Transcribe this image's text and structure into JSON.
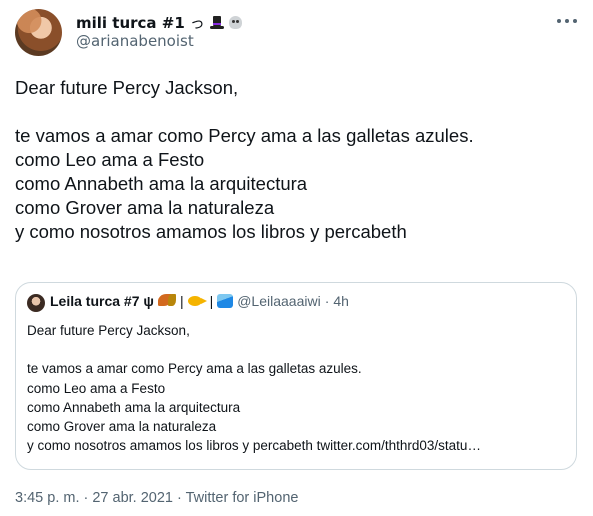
{
  "author": {
    "name": "mili turca #1",
    "name_suffix": "っ",
    "handle": "@arianabenoist",
    "badge_icons": [
      "top-hat-icon",
      "skull-icon"
    ]
  },
  "tweet": {
    "text": "Dear future Percy Jackson,\n\nte vamos a amar como Percy ama a las galletas azules.\ncomo Leo ama a Festo\ncomo Annabeth ama la arquitectura\ncomo Grover ama la naturaleza\ny como nosotros amamos los libros y percabeth"
  },
  "quote": {
    "name": "Leila turca #7 ψ",
    "separator": "|",
    "handle": "@Leilaaaaiwi",
    "dot": "·",
    "time": "4h",
    "icons": [
      "leaf-icon",
      "fish-icon",
      "wave-icon"
    ],
    "text": "Dear future Percy Jackson,\n\nte vamos a amar como Percy ama a las galletas azules.\ncomo Leo ama a Festo\ncomo Annabeth ama la arquitectura\ncomo Grover ama la naturaleza\ny como nosotros amamos los libros y percabeth twitter.com/ththrd03/statu…"
  },
  "meta": {
    "text": "3:45 p. m. · 27 abr. 2021 · Twitter for iPhone"
  }
}
